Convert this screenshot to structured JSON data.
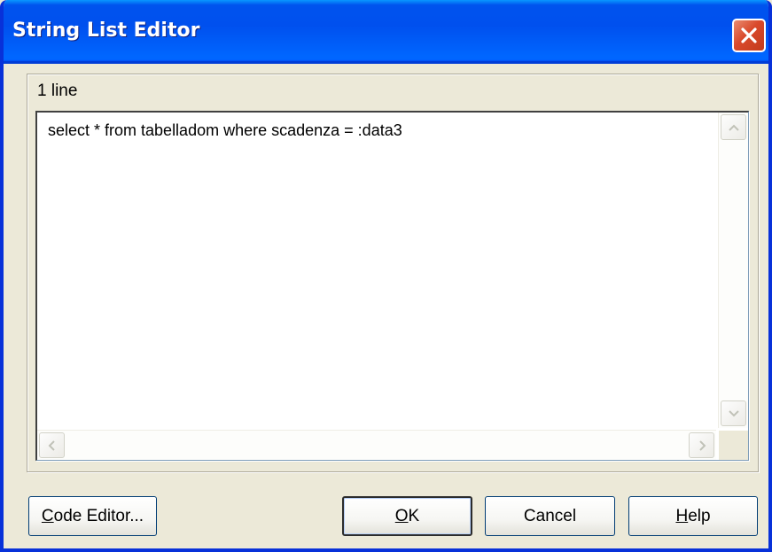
{
  "window": {
    "title": "String List Editor"
  },
  "editor": {
    "line_count": "1 line",
    "content": "select * from tabelladom where scadenza = :data3"
  },
  "buttons": {
    "code_editor": {
      "mnemonic": "C",
      "rest": "ode Editor..."
    },
    "ok": {
      "mnemonic": "O",
      "rest": "K"
    },
    "cancel": "Cancel",
    "help": {
      "mnemonic": "H",
      "rest": "elp"
    }
  },
  "colors": {
    "titlebar": "#0054e3",
    "close_button": "#d9492b",
    "dialog_background": "#ece9d8"
  },
  "icons": {
    "close": "close-icon",
    "scroll_up": "chevron-up-icon",
    "scroll_down": "chevron-down-icon",
    "scroll_left": "chevron-left-icon",
    "scroll_right": "chevron-right-icon"
  }
}
